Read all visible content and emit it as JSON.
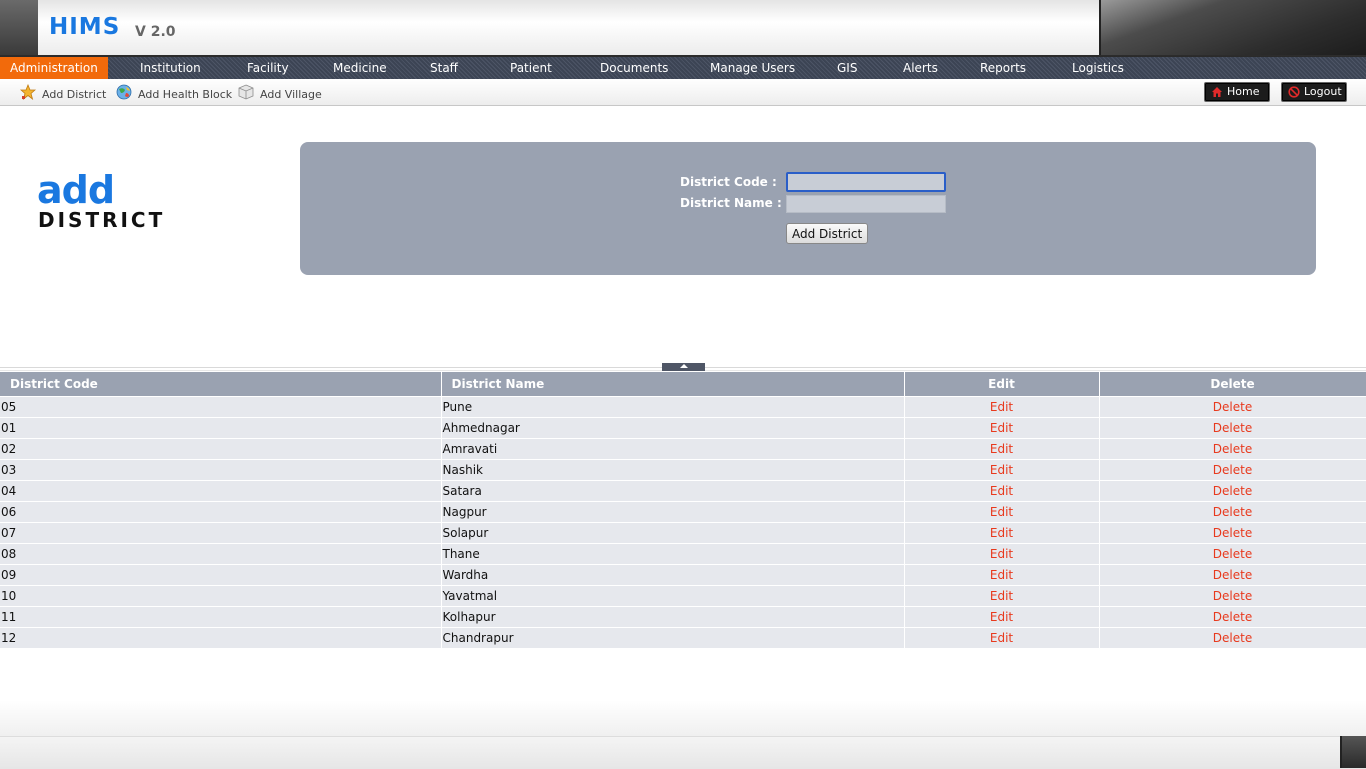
{
  "app": {
    "title": "HIMS",
    "version": "V 2.0"
  },
  "nav": {
    "items": [
      {
        "label": "Administration",
        "active": true
      },
      {
        "label": "Institution"
      },
      {
        "label": "Facility"
      },
      {
        "label": "Medicine"
      },
      {
        "label": "Staff"
      },
      {
        "label": "Patient"
      },
      {
        "label": "Documents"
      },
      {
        "label": "Manage Users"
      },
      {
        "label": "GIS"
      },
      {
        "label": "Alerts"
      },
      {
        "label": "Reports"
      },
      {
        "label": "Logistics"
      }
    ],
    "active_color": "#f26a0b"
  },
  "subnav": {
    "links": [
      {
        "label": "Add District",
        "icon": "star-icon"
      },
      {
        "label": "Add Health Block",
        "icon": "globe-icon"
      },
      {
        "label": "Add Village",
        "icon": "box-icon"
      }
    ],
    "home_label": "Home",
    "logout_label": "Logout"
  },
  "page_title": {
    "line1": "add",
    "line2": "DISTRICT"
  },
  "form": {
    "code_label": "District Code :",
    "name_label": "District Name :",
    "code_value": "",
    "name_value": "",
    "submit_label": "Add District"
  },
  "table": {
    "headers": [
      "District Code",
      "District Name",
      "Edit",
      "Delete"
    ],
    "rows": [
      {
        "code": "05",
        "name": "Pune",
        "edit": "Edit",
        "delete": "Delete"
      },
      {
        "code": "01",
        "name": "Ahmednagar",
        "edit": "Edit",
        "delete": "Delete"
      },
      {
        "code": "02",
        "name": "Amravati",
        "edit": "Edit",
        "delete": "Delete"
      },
      {
        "code": "03",
        "name": "Nashik",
        "edit": "Edit",
        "delete": "Delete"
      },
      {
        "code": "04",
        "name": "Satara",
        "edit": "Edit",
        "delete": "Delete"
      },
      {
        "code": "06",
        "name": "Nagpur",
        "edit": "Edit",
        "delete": "Delete"
      },
      {
        "code": "07",
        "name": "Solapur",
        "edit": "Edit",
        "delete": "Delete"
      },
      {
        "code": "08",
        "name": "Thane",
        "edit": "Edit",
        "delete": "Delete"
      },
      {
        "code": "09",
        "name": "Wardha",
        "edit": "Edit",
        "delete": "Delete"
      },
      {
        "code": "10",
        "name": "Yavatmal",
        "edit": "Edit",
        "delete": "Delete"
      },
      {
        "code": "11",
        "name": "Kolhapur",
        "edit": "Edit",
        "delete": "Delete"
      },
      {
        "code": "12",
        "name": "Chandrapur",
        "edit": "Edit",
        "delete": "Delete"
      }
    ]
  },
  "colors": {
    "brand_blue": "#1a78e0",
    "panel_gray": "#9aa2b1",
    "link_red": "#e8391d"
  }
}
